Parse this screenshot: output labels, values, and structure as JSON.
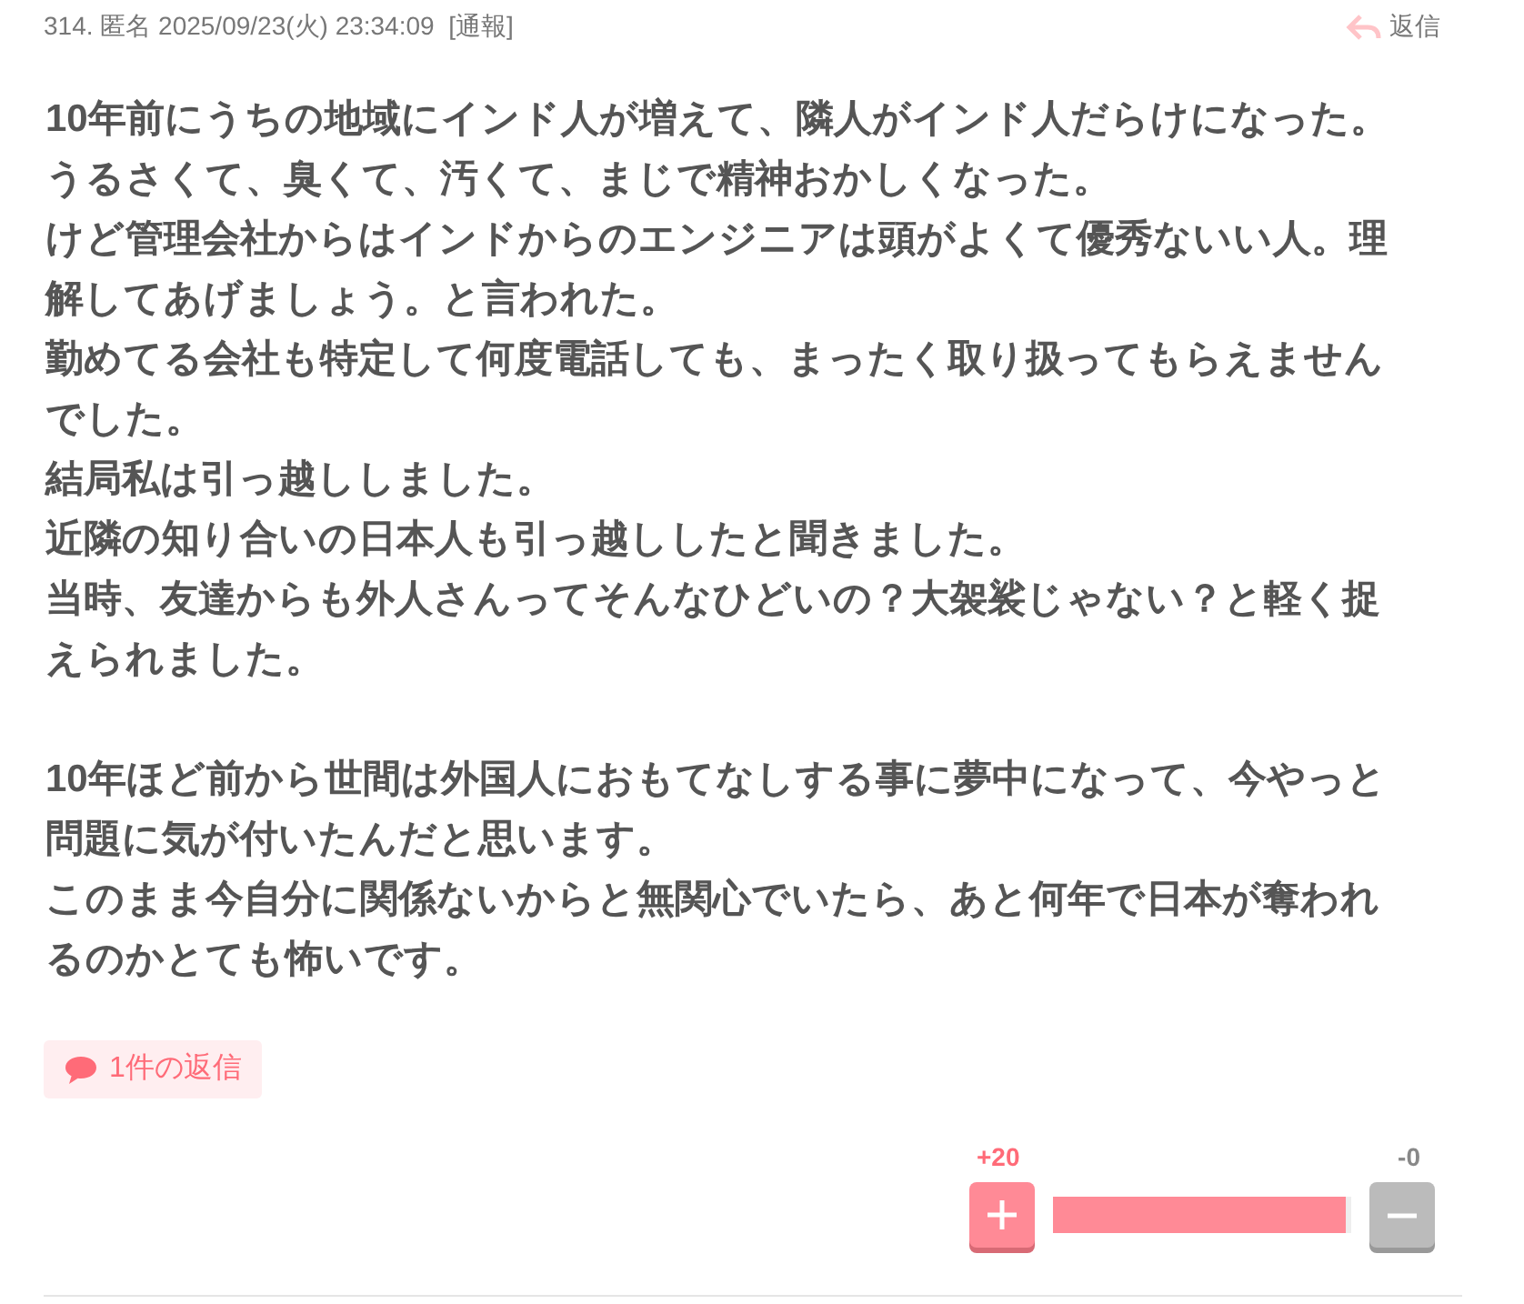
{
  "post": {
    "number": "314.",
    "author": "匿名",
    "datetime": "2025/09/23(火) 23:34:09",
    "report": "[通報]",
    "reply": "返信"
  },
  "body": [
    [
      "10年前にうちの地域にインド人が増えて、隣人がインド人だらけになった。",
      "うるさくて、臭くて、汚くて、まじで精神おかしくなった。",
      "けど管理会社からはインドからのエンジニアは頭がよくて優秀ないい人。理",
      "解してあげましょう。と言われた。",
      "勤めてる会社も特定して何度電話しても、まったく取り扱ってもらえません",
      "でした。",
      "結局私は引っ越ししました。",
      "近隣の知り合いの日本人も引っ越ししたと聞きました。",
      "当時、友達からも外人さんってそんなひどいの？大袈裟じゃない？と軽く捉",
      "えられました。"
    ],
    [
      "10年ほど前から世間は外国人におもてなしする事に夢中になって、今やっと",
      "問題に気が付いたんだと思います。",
      "このまま今自分に関係ないからと無関心でいたら、あと何年で日本が奪われ",
      "るのかとても怖いです。"
    ]
  ],
  "replies_link": "1件の返信",
  "vote": {
    "plus": "+20",
    "minus": "-0",
    "level": 0.98
  }
}
